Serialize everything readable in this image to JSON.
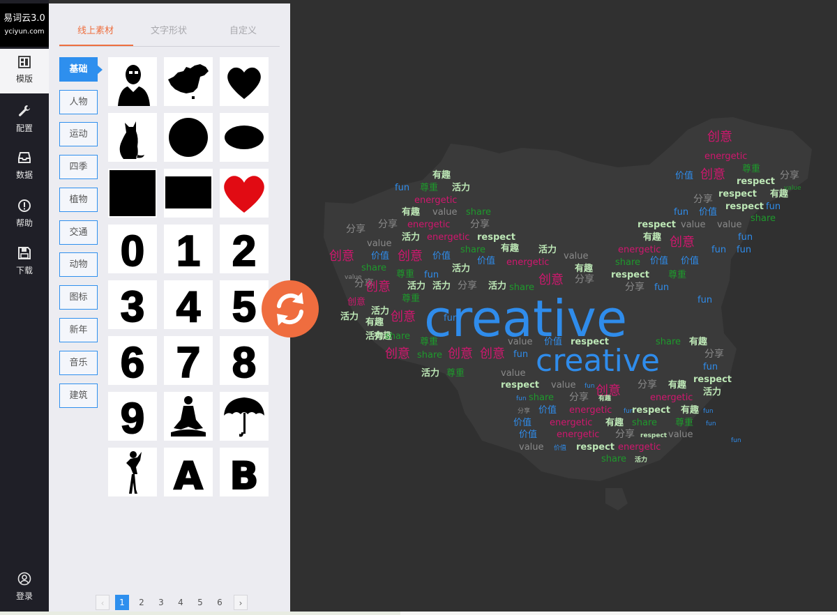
{
  "app": {
    "title": "易词云3.0",
    "subtitle": "yciyun.com"
  },
  "nav": [
    {
      "id": "template",
      "label": "模版",
      "icon": "grid-icon",
      "active": true
    },
    {
      "id": "config",
      "label": "配置",
      "icon": "wrench-icon"
    },
    {
      "id": "data",
      "label": "数据",
      "icon": "inbox-icon"
    },
    {
      "id": "help",
      "label": "帮助",
      "icon": "info-icon"
    },
    {
      "id": "download",
      "label": "下载",
      "icon": "save-icon"
    }
  ],
  "login": {
    "label": "登录",
    "icon": "user-icon"
  },
  "tabs": [
    {
      "label": "线上素材",
      "active": true
    },
    {
      "label": "文字形状"
    },
    {
      "label": "自定义"
    }
  ],
  "categories": [
    "基础",
    "人物",
    "运动",
    "四季",
    "植物",
    "交通",
    "动物",
    "图标",
    "新年",
    "音乐",
    "建筑"
  ],
  "active_category": "基础",
  "shapes": [
    {
      "name": "portrait-silhouette"
    },
    {
      "name": "china-map"
    },
    {
      "name": "heart"
    },
    {
      "name": "cat"
    },
    {
      "name": "circle"
    },
    {
      "name": "ellipse"
    },
    {
      "name": "square"
    },
    {
      "name": "rectangle"
    },
    {
      "name": "red-heart"
    },
    {
      "name": "digit",
      "text": "0"
    },
    {
      "name": "digit",
      "text": "1"
    },
    {
      "name": "digit",
      "text": "2"
    },
    {
      "name": "digit",
      "text": "3"
    },
    {
      "name": "digit",
      "text": "4"
    },
    {
      "name": "digit",
      "text": "5"
    },
    {
      "name": "digit",
      "text": "6"
    },
    {
      "name": "digit",
      "text": "7"
    },
    {
      "name": "digit",
      "text": "8"
    },
    {
      "name": "digit",
      "text": "9"
    },
    {
      "name": "meditation"
    },
    {
      "name": "umbrella"
    },
    {
      "name": "dancer"
    },
    {
      "name": "letter",
      "text": "A"
    },
    {
      "name": "letter",
      "text": "B"
    }
  ],
  "pagination": {
    "pages": [
      "1",
      "2",
      "3",
      "4",
      "5",
      "6"
    ],
    "current": "1",
    "prev": "‹",
    "next": "›"
  },
  "colors": {
    "accent": "#ee6f3f",
    "blue": "#2e8fee",
    "word_blue": "#2f8ceb",
    "word_pink": "#d0176e",
    "word_green": "#1e9a2c",
    "word_lightgreen": "#bde7b6",
    "word_gray": "#8a8a8a",
    "background": "#303030"
  },
  "wordcloud": {
    "shape": "china-map",
    "words": [
      {
        "text": "creative",
        "color": "blue",
        "size": 72
      },
      {
        "text": "creative",
        "color": "blue",
        "size": 44
      },
      {
        "text": "创意",
        "color": "pink",
        "size": 17
      },
      {
        "text": "energetic",
        "color": "pink",
        "size": 13
      },
      {
        "text": "尊重",
        "color": "green",
        "size": 13
      },
      {
        "text": "价值",
        "color": "blue",
        "size": 13
      },
      {
        "text": "分享",
        "color": "gray",
        "size": 13
      },
      {
        "text": "有趣",
        "color": "light",
        "size": 13
      },
      {
        "text": "share",
        "color": "green",
        "size": 13
      },
      {
        "text": "respect",
        "color": "light",
        "size": 13
      },
      {
        "text": "fun",
        "color": "blue",
        "size": 13
      },
      {
        "text": "value",
        "color": "gray",
        "size": 13
      },
      {
        "text": "活力",
        "color": "light",
        "size": 13
      }
    ]
  }
}
